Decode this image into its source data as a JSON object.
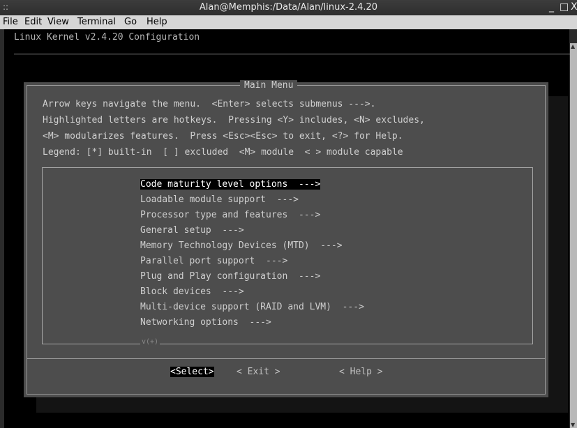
{
  "window": {
    "title": "Alan@Memphis:/Data/Alan/linux-2.4.20",
    "grip_glyph": "::",
    "minimize_glyph": "_",
    "maximize_glyph": "□",
    "close_glyph": "X"
  },
  "menubar": {
    "file": "File",
    "edit": "Edit",
    "view": "View",
    "terminal": "Terminal",
    "go": "Go",
    "help": "Help"
  },
  "terminal": {
    "header": "Linux Kernel v2.4.20 Configuration",
    "dialog_title": "Main Menu",
    "help_lines": [
      "Arrow keys navigate the menu.  <Enter> selects submenus --->.",
      "Highlighted letters are hotkeys.  Pressing <Y> includes, <N> excludes,",
      "<M> modularizes features.  Press <Esc><Esc> to exit, <?> for Help.",
      "Legend: [*] built-in  [ ] excluded  <M> module  < > module capable"
    ],
    "menu_items": [
      {
        "label": "Code maturity level options  --->",
        "selected": true
      },
      {
        "label": "Loadable module support  --->"
      },
      {
        "label": "Processor type and features  --->"
      },
      {
        "label": "General setup  --->"
      },
      {
        "label": "Memory Technology Devices (MTD)  --->"
      },
      {
        "label": "Parallel port support  --->"
      },
      {
        "label": "Plug and Play configuration  --->"
      },
      {
        "label": "Block devices  --->"
      },
      {
        "label": "Multi-device support (RAID and LVM)  --->"
      },
      {
        "label": "Networking options  --->"
      }
    ],
    "more_indicator": "v(+)",
    "buttons": {
      "select": "<Select>",
      "exit": "< Exit >",
      "help": "< Help >"
    }
  }
}
